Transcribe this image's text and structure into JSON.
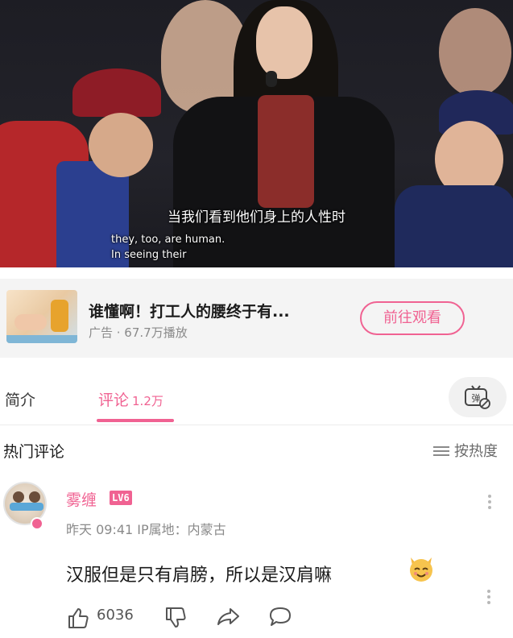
{
  "video": {
    "subtitle_cn": "当我们看到他们身上的人性时",
    "subtitle_en": "they, too, are human.\nIn seeing their"
  },
  "ad": {
    "title": "谁懂啊！打工人的腰终于有...",
    "meta": "广告 · 67.7万播放",
    "button_label": "前往观看",
    "more_icon": "more-vertical-icon"
  },
  "tabs": {
    "intro_label": "简介",
    "comments_label": "评论",
    "comments_count": "1.2万",
    "danmu_icon": "danmu-toggle-icon",
    "accent": "#f06292"
  },
  "comments": {
    "section_title": "热门评论",
    "sort_label": "按热度",
    "items": [
      {
        "username": "雾缠",
        "level": "LV6",
        "meta": "昨天 09:41 IP属地：内蒙古",
        "text": "汉服但是只有肩膀，所以是汉肩嘛",
        "emoji": "cat-smile-emoji",
        "likes": "6036"
      }
    ]
  }
}
